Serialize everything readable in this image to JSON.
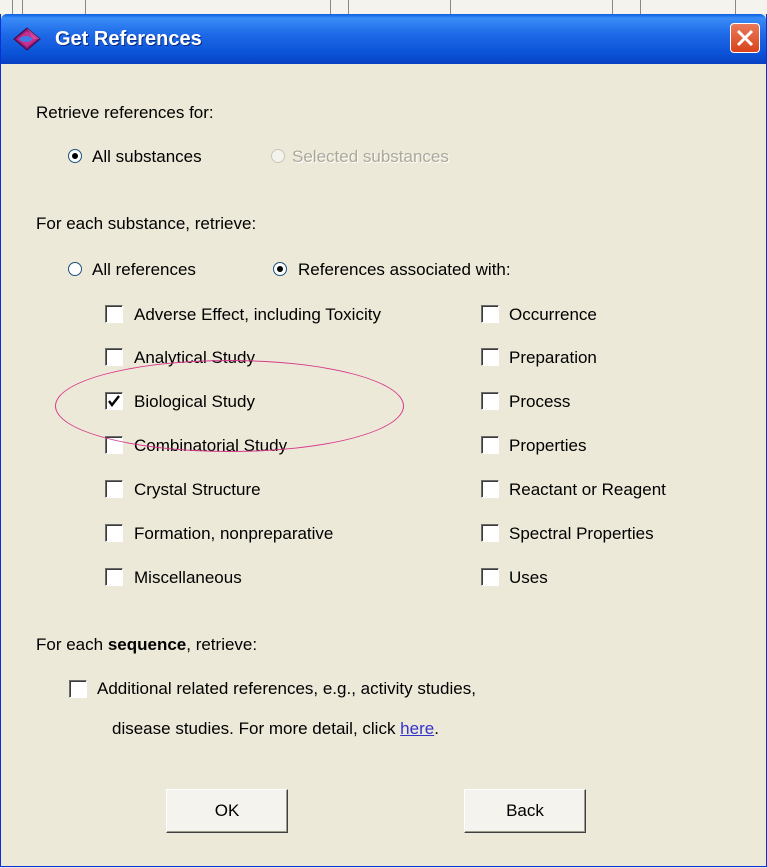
{
  "window": {
    "title": "Get References",
    "close_glyph": "✕"
  },
  "section1": {
    "label": "Retrieve references for:",
    "options": [
      {
        "label": "All substances",
        "selected": true,
        "enabled": true
      },
      {
        "label": "Selected substances",
        "selected": false,
        "enabled": false
      }
    ]
  },
  "section2": {
    "label": "For each substance, retrieve:",
    "options": [
      {
        "label": "All references",
        "selected": false
      },
      {
        "label": "References associated with:",
        "selected": true
      }
    ],
    "left_column": [
      {
        "label": "Adverse Effect, including Toxicity",
        "checked": false
      },
      {
        "label": "Analytical Study",
        "checked": false
      },
      {
        "label": "Biological Study",
        "checked": true
      },
      {
        "label": "Combinatorial Study",
        "checked": false
      },
      {
        "label": "Crystal Structure",
        "checked": false
      },
      {
        "label": "Formation, nonpreparative",
        "checked": false
      },
      {
        "label": "Miscellaneous",
        "checked": false
      }
    ],
    "right_column": [
      {
        "label": "Occurrence",
        "checked": false
      },
      {
        "label": "Preparation",
        "checked": false
      },
      {
        "label": "Process",
        "checked": false
      },
      {
        "label": "Properties",
        "checked": false
      },
      {
        "label": "Reactant or Reagent",
        "checked": false
      },
      {
        "label": "Spectral Properties",
        "checked": false
      },
      {
        "label": "Uses",
        "checked": false
      }
    ]
  },
  "section3": {
    "label_prefix": "For each ",
    "label_bold": "sequence",
    "label_suffix": ", retrieve:",
    "checkbox_line1": "Additional related references, e.g., activity studies,",
    "checkbox_line2": "disease studies.  For more detail, click ",
    "link_text": "here",
    "line2_end": ".",
    "checked": false
  },
  "buttons": {
    "ok": "OK",
    "back": "Back"
  },
  "colors": {
    "title_bar": "#0a52d6",
    "dialog_bg": "#ece9d8",
    "annotation_ellipse": "#d63a8a",
    "link": "#3333cc"
  }
}
